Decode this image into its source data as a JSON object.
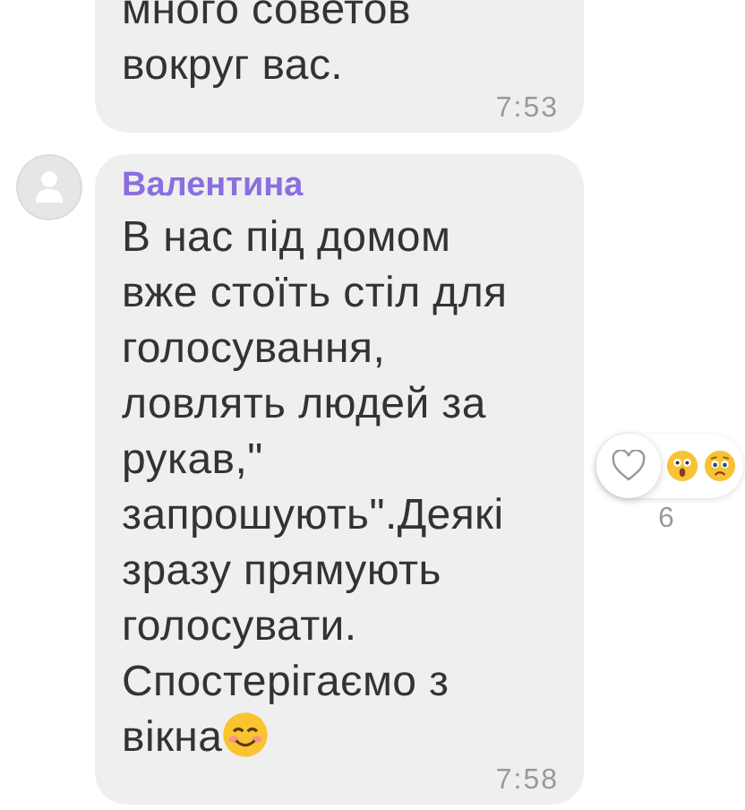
{
  "messages": [
    {
      "text": "много советов\nвокруг вас.",
      "time": "7:53"
    },
    {
      "sender": "Валентина",
      "text": "В нас під домом\nвже стоїть стіл для\nголосування,\nловлять людей за\nрукав,\"\nзапрошують\".Деякі\nзразу прямують\nголосувати.\nСпостерігаємо з\nвікна",
      "emoji_end": true,
      "time": "7:58",
      "avatar": true,
      "reactions": {
        "liked": false,
        "count": "6"
      }
    }
  ]
}
